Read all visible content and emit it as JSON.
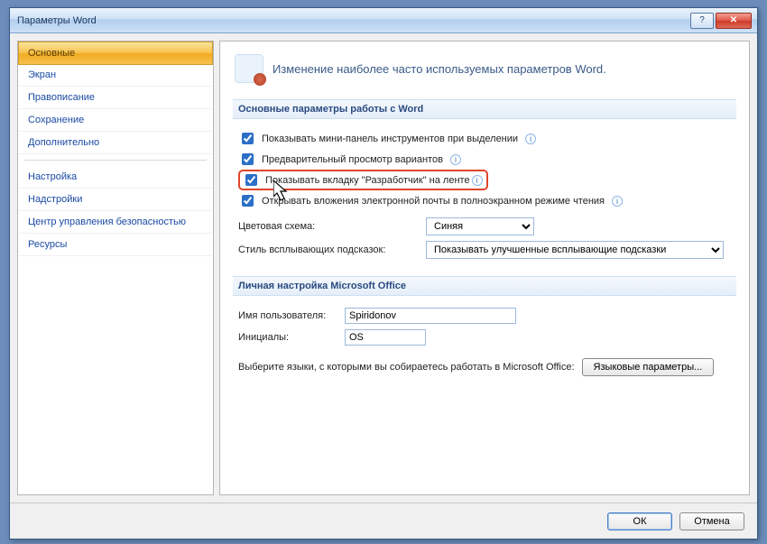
{
  "title": "Параметры Word",
  "sidebar": {
    "items": [
      {
        "label": "Основные",
        "selected": true
      },
      {
        "label": "Экран"
      },
      {
        "label": "Правописание"
      },
      {
        "label": "Сохранение"
      },
      {
        "label": "Дополнительно"
      },
      {
        "label": "Настройка"
      },
      {
        "label": "Надстройки"
      },
      {
        "label": "Центр управления безопасностью"
      },
      {
        "label": "Ресурсы"
      }
    ]
  },
  "main": {
    "heading": "Изменение наиболее часто используемых параметров Word.",
    "section1": {
      "title": "Основные параметры работы с Word",
      "opts": [
        {
          "label": "Показывать мини-панель инструментов при выделении",
          "checked": true,
          "info": true
        },
        {
          "label": "Предварительный просмотр вариантов",
          "checked": true,
          "info": true
        },
        {
          "label": "Показывать вкладку \"Разработчик\" на ленте",
          "checked": true,
          "info": true,
          "highlight": true
        },
        {
          "label": "Открывать вложения электронной почты в полноэкранном режиме чтения",
          "checked": true,
          "info": true
        }
      ],
      "color_label": "Цветовая схема:",
      "color_value": "Синяя",
      "tooltip_label": "Стиль всплывающих подсказок:",
      "tooltip_value": "Показывать улучшенные всплывающие подсказки"
    },
    "section2": {
      "title": "Личная настройка Microsoft Office",
      "user_label": "Имя пользователя:",
      "user_value": "Spiridonov",
      "init_label": "Инициалы:",
      "init_value": "OS",
      "lang_text": "Выберите языки, с которыми вы собираетесь работать в Microsoft Office:",
      "lang_btn": "Языковые параметры..."
    }
  },
  "footer": {
    "ok": "ОК",
    "cancel": "Отмена"
  }
}
